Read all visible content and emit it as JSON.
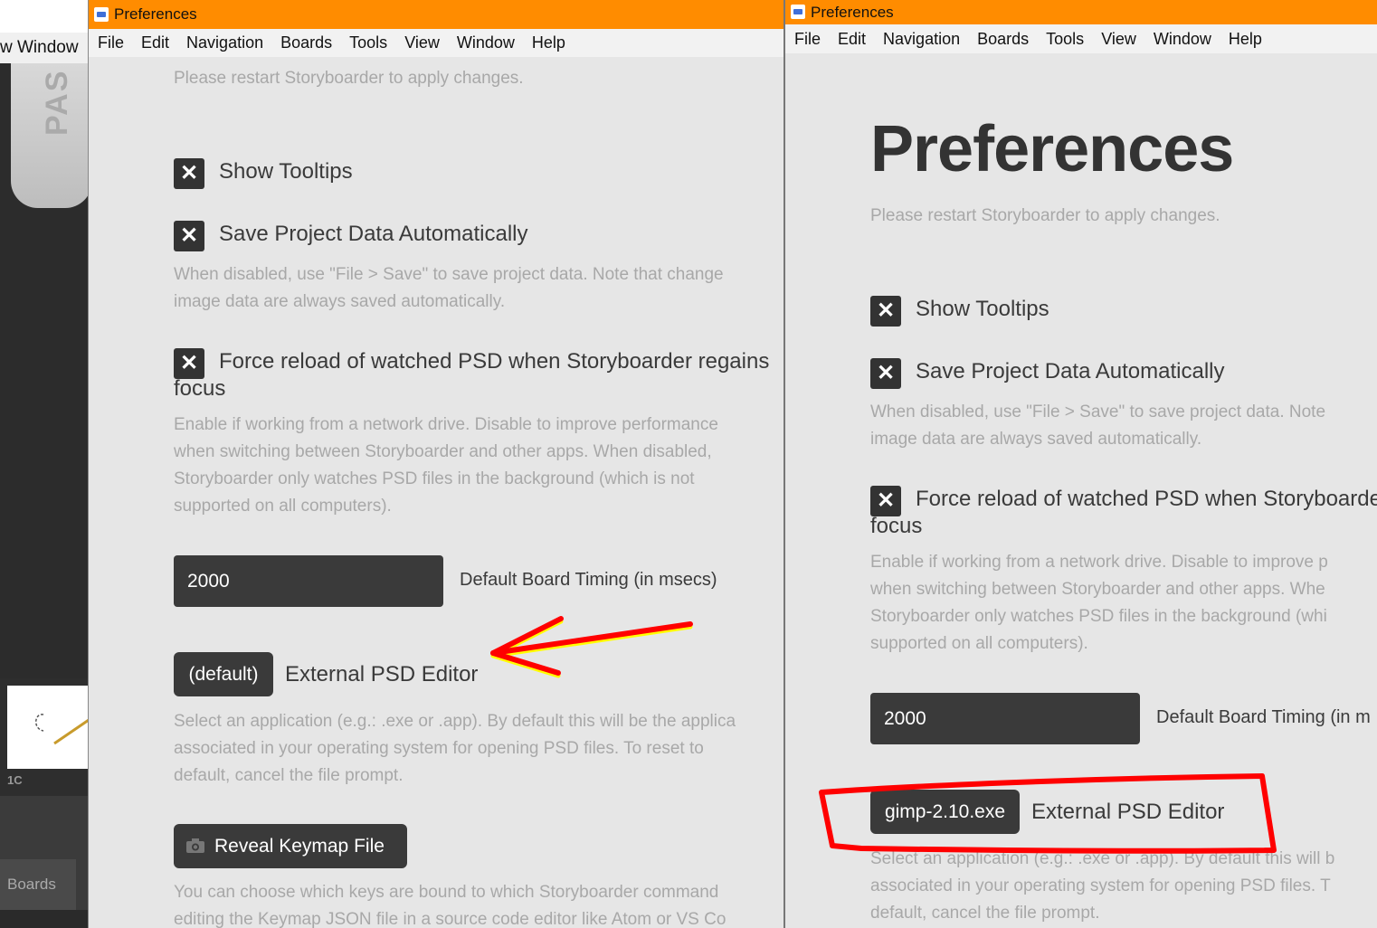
{
  "background_app": {
    "menu_fragment": "w Window",
    "logo_text": "PAS",
    "thumb_label": "1C",
    "boards_tab": "Boards"
  },
  "left_window": {
    "title": "Preferences",
    "menu": [
      "File",
      "Edit",
      "Navigation",
      "Boards",
      "Tools",
      "View",
      "Window",
      "Help"
    ],
    "restart_note": "Please restart Storyboarder to apply changes.",
    "show_tooltips": "Show Tooltips",
    "save_auto": "Save Project Data Automatically",
    "save_auto_hint_1": "When disabled, use \"File > Save\" to save project data. Note that change",
    "save_auto_hint_2": "image data are always saved automatically.",
    "force_reload_1": "Force reload of watched PSD when Storyboarder regains",
    "force_reload_2": "focus",
    "force_reload_hint_1": "Enable if working from a network drive. Disable to improve performance",
    "force_reload_hint_2": "when switching between Storyboarder and other apps. When disabled,",
    "force_reload_hint_3": "Storyboarder only watches PSD files in the background (which is not",
    "force_reload_hint_4": "supported on all computers).",
    "timing_value": "2000",
    "timing_label": "Default Board Timing (in msecs)",
    "psd_editor_value": "(default)",
    "psd_editor_label": "External PSD Editor",
    "psd_hint_1": "Select an application (e.g.: .exe or .app). By default this will be the applica",
    "psd_hint_2": "associated in your operating system for opening PSD files. To reset to",
    "psd_hint_3": "default, cancel the file prompt.",
    "keymap_button": "Reveal Keymap File",
    "keymap_hint_1": "You can choose which keys are bound to which Storyboarder command",
    "keymap_hint_2": "editing the Keymap JSON file in a source code editor like Atom or VS Co"
  },
  "right_window": {
    "title": "Preferences",
    "menu": [
      "File",
      "Edit",
      "Navigation",
      "Boards",
      "Tools",
      "View",
      "Window",
      "Help"
    ],
    "heading": "Preferences",
    "restart_note": "Please restart Storyboarder to apply changes.",
    "show_tooltips": "Show Tooltips",
    "save_auto": "Save Project Data Automatically",
    "save_auto_hint_1": "When disabled, use \"File > Save\" to save project data. Note",
    "save_auto_hint_2": "image data are always saved automatically.",
    "force_reload_1": "Force reload of watched PSD when Storyboarde",
    "force_reload_2": "focus",
    "force_reload_hint_1": "Enable if working from a network drive. Disable to improve p",
    "force_reload_hint_2": "when switching between Storyboarder and other apps. Whe",
    "force_reload_hint_3": "Storyboarder only watches PSD files in the background (whi",
    "force_reload_hint_4": "supported on all computers).",
    "timing_value": "2000",
    "timing_label": "Default Board Timing (in m",
    "psd_editor_value": "gimp-2.10.exe",
    "psd_editor_label": "External PSD Editor",
    "psd_hint_1": "Select an application (e.g.: .exe or .app). By default this will b",
    "psd_hint_2": "associated in your operating system for opening PSD files. T",
    "psd_hint_3": "default, cancel the file prompt."
  },
  "checkbox_glyph": "✕",
  "colors": {
    "titlebar": "#ff8c00",
    "annotation_red": "#ff0000",
    "annotation_yellow": "#ffff00"
  }
}
